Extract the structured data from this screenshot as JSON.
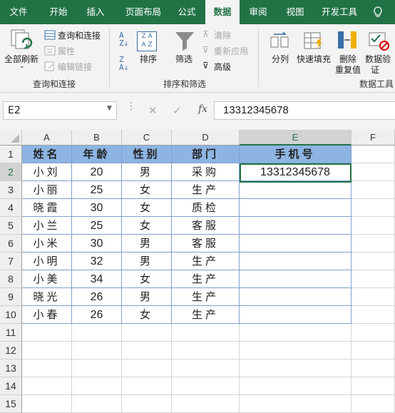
{
  "tabs": [
    "文件",
    "开始",
    "插入",
    "页面布局",
    "公式",
    "数据",
    "审阅",
    "视图",
    "开发工具"
  ],
  "active_tab": "数据",
  "ribbon": {
    "refresh_all": "全部刷新",
    "query_connections": "查询和连接",
    "properties": "属性",
    "edit_links": "编辑链接",
    "group1": "查询和连接",
    "sort": "排序",
    "filter": "筛选",
    "clear": "清除",
    "reapply": "重新应用",
    "advanced": "高级",
    "group2": "排序和筛选",
    "split": "分列",
    "flash_fill": "快速填充",
    "remove_dup_1": "删除",
    "remove_dup_2": "重复值",
    "validate_1": "数据验",
    "validate_2": "证",
    "group3": "数据工具"
  },
  "namebox": "E2",
  "formula": "13312345678",
  "columns": [
    "A",
    "B",
    "C",
    "D",
    "E",
    "F"
  ],
  "rows": [
    "1",
    "2",
    "3",
    "4",
    "5",
    "6",
    "7",
    "8",
    "9",
    "10",
    "11",
    "12",
    "13",
    "14",
    "15"
  ],
  "table": {
    "header": [
      "姓名",
      "年龄",
      "性别",
      "部门",
      "手机号"
    ],
    "data": [
      [
        "小刘",
        "20",
        "男",
        "采购",
        "13312345678"
      ],
      [
        "小丽",
        "25",
        "女",
        "生产",
        ""
      ],
      [
        "晓霞",
        "30",
        "女",
        "质检",
        ""
      ],
      [
        "小兰",
        "25",
        "女",
        "客服",
        ""
      ],
      [
        "小米",
        "30",
        "男",
        "客服",
        ""
      ],
      [
        "小明",
        "32",
        "男",
        "生产",
        ""
      ],
      [
        "小美",
        "34",
        "女",
        "生产",
        ""
      ],
      [
        "晓光",
        "26",
        "男",
        "生产",
        ""
      ],
      [
        "小春",
        "26",
        "女",
        "生产",
        ""
      ]
    ]
  },
  "colors": {
    "green": "#217346",
    "header_fill": "#8db4e2"
  }
}
